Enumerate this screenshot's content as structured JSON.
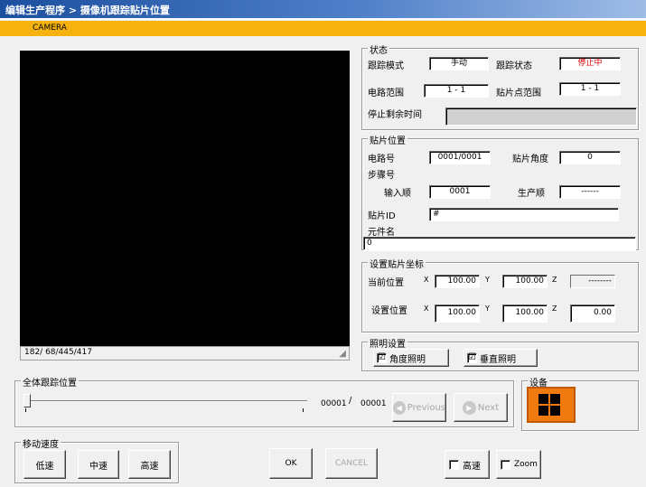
{
  "window": {
    "title": "编辑生产程序 > 摄像机跟踪贴片位置",
    "camera_label": "CAMERA"
  },
  "camera": {
    "coords": "182/ 68/445/417"
  },
  "status": {
    "legend": "状态",
    "track_mode_label": "跟踪模式",
    "track_mode_value": "手动",
    "track_state_label": "跟踪状态",
    "track_state_value": "停止中",
    "circuit_range_label": "电路范围",
    "circuit_range_value": "1 - 1",
    "mount_range_label": "贴片点范围",
    "mount_range_value": "1 - 1",
    "stop_remaining_label": "停止剩余时间",
    "stop_remaining_value": ""
  },
  "mount_position": {
    "legend": "贴片位置",
    "circuit_no_label": "电路号",
    "circuit_no_value": "0001/0001",
    "mount_angle_label": "贴片角度",
    "mount_angle_value": "0",
    "step_no_label": "步骤号",
    "input_order_label": "输入顺",
    "input_order_value": "0001",
    "prod_order_label": "生产顺",
    "prod_order_value": "------",
    "mount_id_label": "贴片ID",
    "mount_id_value": "#",
    "component_name_label": "元件名",
    "component_name_value": "0"
  },
  "coords_setting": {
    "legend": "设置贴片坐标",
    "current_label": "当前位置",
    "setpos_label": "设置位置",
    "x": "X",
    "y": "Y",
    "z": "Z",
    "current_x": "100.00",
    "current_y": "100.00",
    "current_z": "--------",
    "set_x": "100.00",
    "set_y": "100.00",
    "set_z": "0.00"
  },
  "lighting": {
    "legend": "照明设置",
    "angle_light": "角度照明",
    "angle_light_checked": "☑",
    "vertical_light": "垂直照明",
    "vertical_light_checked": "☑"
  },
  "tracking": {
    "legend": "全体跟踪位置",
    "current": "00001",
    "separator": "/",
    "total": "00001",
    "previous_label": "Previous",
    "next_label": "Next",
    "position_fraction": 0
  },
  "device": {
    "legend": "设备"
  },
  "speed": {
    "legend": "移动速度",
    "low": "低速",
    "mid": "中速",
    "high": "高速"
  },
  "actions": {
    "ok": "OK",
    "cancel": "CANCEL",
    "high_speed": "高速",
    "zoom": "Zoom"
  }
}
